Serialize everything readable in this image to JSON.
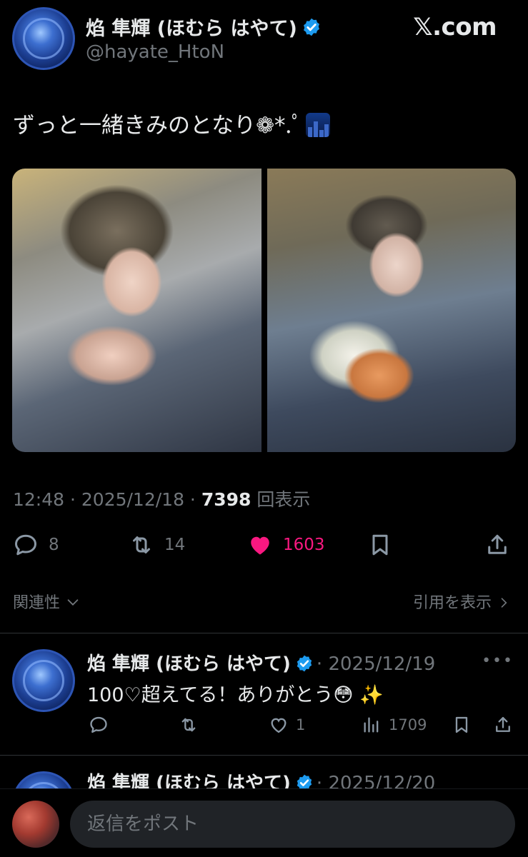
{
  "author": {
    "name": "焰 隼輝 (ほむら はやて)",
    "handle": "@hayate_HtoN",
    "verified": true
  },
  "brand": "𝕏.com",
  "tweet": {
    "text": "ずっと一緒きみのとなり❁*.ﾟ",
    "emoji": "city-night-emoji",
    "time": "12:48",
    "date": "2025/12/18",
    "views": "7398",
    "views_label": "回表示",
    "media": [
      "photo-1",
      "photo-2"
    ]
  },
  "actions": {
    "replies": "8",
    "reposts": "14",
    "likes": "1603",
    "liked": true
  },
  "links": {
    "related": "関連性",
    "quotes": "引用を表示"
  },
  "replies": [
    {
      "name": "焰 隼輝 (ほむら はやて)",
      "date": "2025/12/19",
      "text": "100♡超えてる！ありがとう😳 ✨",
      "reply_count": "",
      "repost_count": "",
      "like_count": "1",
      "views": "1709"
    },
    {
      "name": "焰 隼輝 (ほむら はやて)",
      "date": "2025/12/20"
    }
  ],
  "composer": {
    "placeholder": "返信をポスト"
  },
  "colors": {
    "background": "#000000",
    "text": "#e7e9ea",
    "muted": "#71767b",
    "verified": "#1d9bf0",
    "like": "#f91880"
  }
}
